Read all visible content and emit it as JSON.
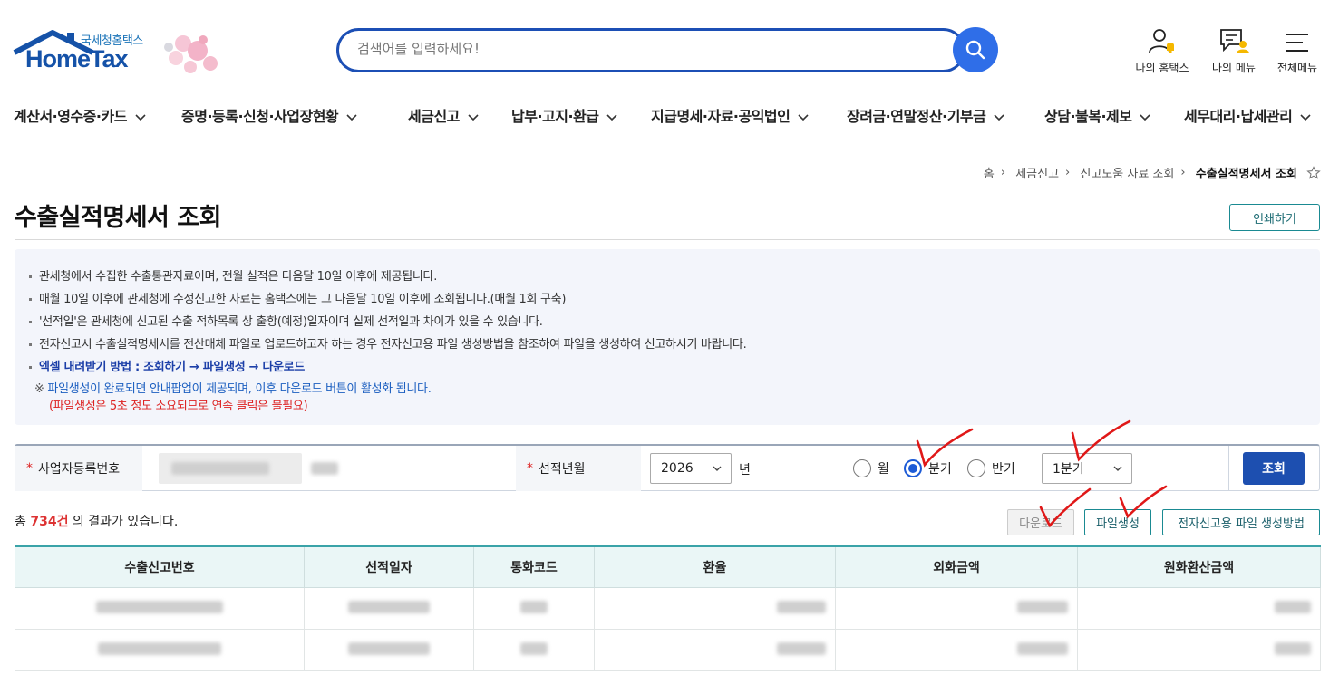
{
  "header": {
    "logo_sub": "국세청홈택스",
    "logo_main": "HomeTax",
    "search_placeholder": "검색어를 입력하세요!",
    "links": [
      "나의 홈택스",
      "나의 메뉴",
      "전체메뉴"
    ]
  },
  "gnb": [
    "계산서·영수증·카드",
    "증명·등록·신청·사업장현황",
    "세금신고",
    "납부·고지·환급",
    "지급명세·자료·공익법인",
    "장려금·연말정산·기부금",
    "상담·불복·제보",
    "세무대리·납세관리"
  ],
  "breadcrumb": [
    "홈",
    "세금신고",
    "신고도움 자료 조회",
    "수출실적명세서 조회"
  ],
  "page_title": "수출실적명세서 조회",
  "print_label": "인쇄하기",
  "notice": {
    "items": [
      "관세청에서 수집한 수출통관자료이며, 전월 실적은 다음달 10일 이후에 제공됩니다.",
      "매월 10일 이후에 관세청에 수정신고한 자료는 홈택스에는 그 다음달 10일 이후에 조회됩니다.(매월 1회 구축)",
      "'선적일'은 관세청에 신고된 수출 적하목록 상 출항(예정)일자이며 실제 선적일과 차이가 있을 수 있습니다.",
      "전자신고시 수출실적명세서를 전산매체 파일로 업로드하고자 하는 경우 전자신고용 파일 생성방법을 참조하여 파일을 생성하여 신고하시기 바랍니다."
    ],
    "excel_guide": "엑셀 내려받기 방법 :  조회하기 →  파일생성 → 다운로드",
    "note_mark": "※",
    "note": " 파일생성이 완료되면 안내팝업이 제공되며, 이후  다운로드 버튼이 활성화 됩니다.",
    "warn": "(파일생성은 5초 정도 소요되므로 연속 클릭은 불필요)"
  },
  "condition": {
    "brn_label": "사업자등록번호",
    "year_label": "선적년월",
    "year_value": "2026",
    "year_unit": "년",
    "period_options": [
      "월",
      "분기",
      "반기"
    ],
    "period_selected": "분기",
    "quarter_value": "1분기",
    "search_label": "조회",
    "required_mark": "*"
  },
  "result": {
    "prefix": "총 ",
    "count": "734건",
    "suffix": " 의 결과가 있습니다."
  },
  "buttons": {
    "download": "다운로드",
    "file_create": "파일생성",
    "method": "전자신고용 파일 생성방법"
  },
  "table": {
    "headers": [
      "수출신고번호",
      "선적일자",
      "통화코드",
      "환율",
      "외화금액",
      "원화환산금액"
    ]
  },
  "colors": {
    "brand": "#1552a8",
    "search_border": "#1c4fb5",
    "accent_teal": "#1a8a92",
    "count_red": "#d33333"
  }
}
